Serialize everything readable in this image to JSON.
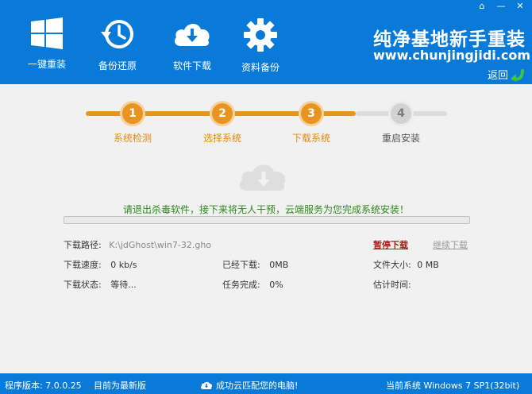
{
  "window": {
    "home_glyph": "⌂",
    "min_glyph": "—",
    "close_glyph": "✕"
  },
  "nav": [
    {
      "label": "一键重装",
      "icon": "windows-logo-icon"
    },
    {
      "label": "备份还原",
      "icon": "history-clock-icon"
    },
    {
      "label": "软件下载",
      "icon": "cloud-download-icon"
    },
    {
      "label": "资料备份",
      "icon": "gear-icon"
    }
  ],
  "brand": {
    "name": "纯净基地新手重装",
    "url": "www.chunjingjidi.com"
  },
  "back": {
    "label": "返回",
    "arrow": "⇠"
  },
  "steps": [
    {
      "num": "1",
      "label": "系统检测",
      "state": "done"
    },
    {
      "num": "2",
      "label": "选择系统",
      "state": "done"
    },
    {
      "num": "3",
      "label": "下载系统",
      "state": "done"
    },
    {
      "num": "4",
      "label": "重启安装",
      "state": "todo"
    }
  ],
  "notice": "请退出杀毒软件，接下来将无人干预，云端服务为您完成系统安装！",
  "progress": {
    "percent": 0
  },
  "download": {
    "path_label": "下载路径:",
    "path_value": "K:\\jdGhost\\win7-32.gho",
    "speed_label": "下载速度:",
    "speed_value": "0 kb/s",
    "state_label": "下载状态:",
    "state_value": "等待...",
    "downloaded_label": "已经下载:",
    "downloaded_value": "0MB",
    "done_label": "任务完成:",
    "done_value": "0%",
    "size_label": "文件大小:",
    "size_value": "0 MB",
    "eta_label": "估计时间:",
    "eta_value": "",
    "pause_label": "暂停下载",
    "resume_label": "继续下载"
  },
  "status": {
    "version": "程序版本: 7.0.0.25",
    "latest": "目前为最新版",
    "cloud_match": "成功云匹配您的电脑!",
    "system": "当前系统 Windows 7 SP1(32bit)"
  },
  "colors": {
    "header_blue": "#0a7ad8",
    "step_orange": "#e89420",
    "notice_green": "#2d8a1d",
    "pause_red": "#b01919"
  }
}
